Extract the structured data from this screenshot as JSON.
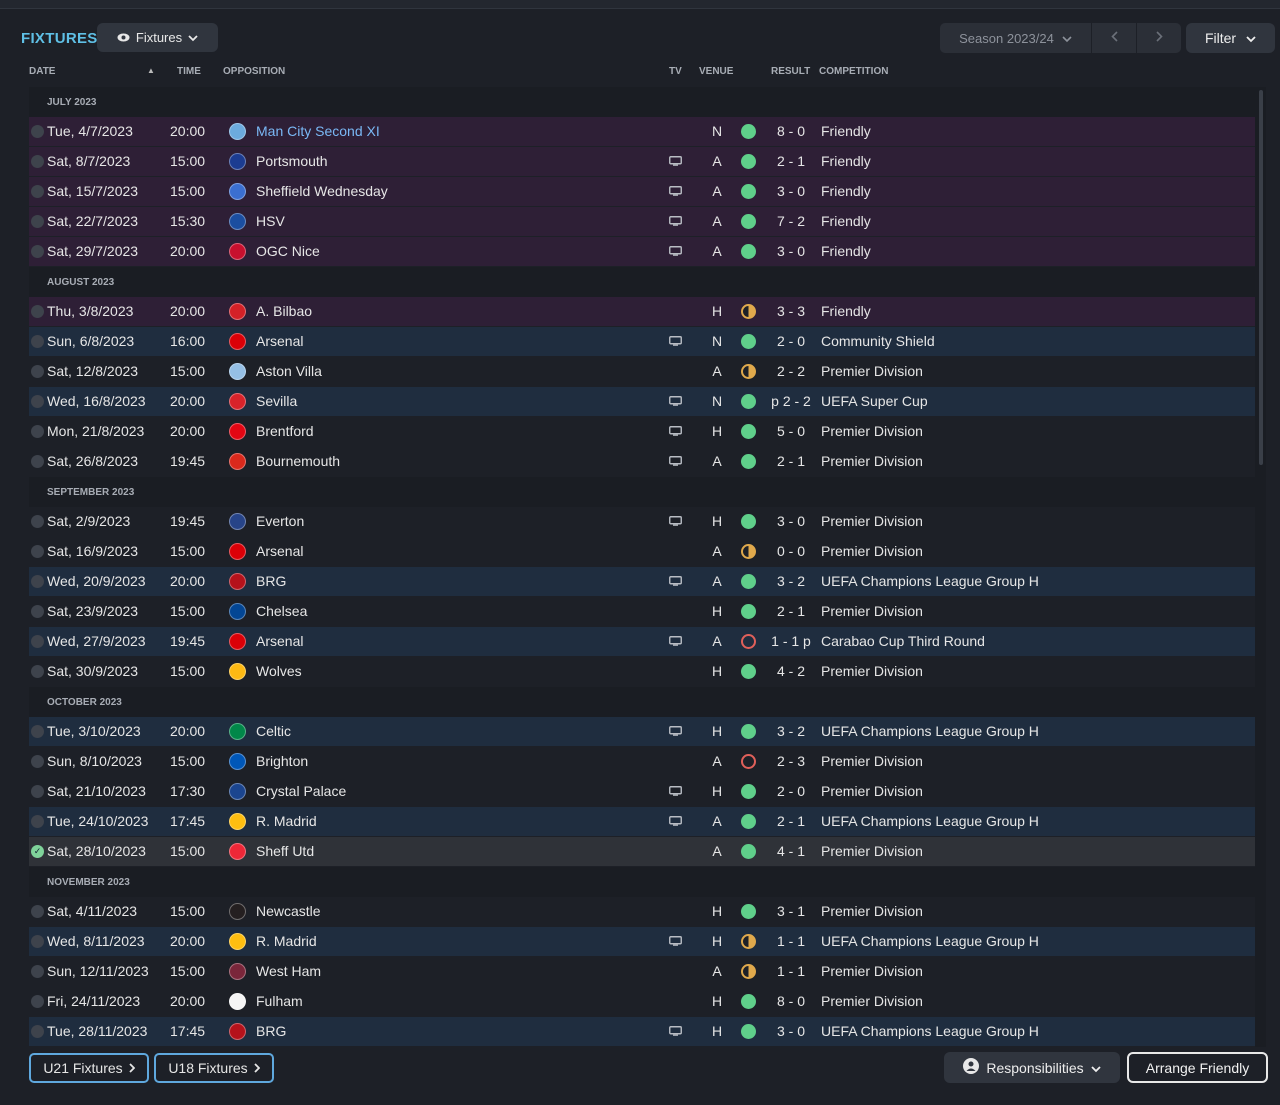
{
  "header": {
    "title": "FIXTURES",
    "view_label": "Fixtures",
    "season_label": "Season 2023/24",
    "filter_label": "Filter"
  },
  "columns": {
    "date": "DATE",
    "time": "TIME",
    "opposition": "OPPOSITION",
    "tv": "TV",
    "venue": "VENUE",
    "result": "RESULT",
    "competition": "COMPETITION"
  },
  "colors": {
    "accent": "#5fc0e6",
    "win": "#5fcf8a",
    "draw": "#e0a94c",
    "loss": "#e0605a",
    "friendly_row": "#2e1f36",
    "cup_row": "#1f2d3f"
  },
  "months": [
    {
      "label": "JULY 2023",
      "fixtures": [
        {
          "date": "Tue, 4/7/2023",
          "time": "20:00",
          "opposition": "Man City Second XI",
          "crest": "#6cabdd",
          "tv": false,
          "venue": "N",
          "result": "W",
          "score": "8 - 0",
          "competition": "Friendly",
          "style": "friendly",
          "link": true,
          "checked": false
        },
        {
          "date": "Sat, 8/7/2023",
          "time": "15:00",
          "opposition": "Portsmouth",
          "crest": "#1c3c91",
          "tv": true,
          "venue": "A",
          "result": "W",
          "score": "2 - 1",
          "competition": "Friendly",
          "style": "friendly",
          "checked": false
        },
        {
          "date": "Sat, 15/7/2023",
          "time": "15:00",
          "opposition": "Sheffield Wednesday",
          "crest": "#3b6fd0",
          "tv": true,
          "venue": "A",
          "result": "W",
          "score": "3 - 0",
          "competition": "Friendly",
          "style": "friendly",
          "checked": false
        },
        {
          "date": "Sat, 22/7/2023",
          "time": "15:30",
          "opposition": "HSV",
          "crest": "#1b4ea0",
          "tv": true,
          "venue": "A",
          "result": "W",
          "score": "7 - 2",
          "competition": "Friendly",
          "style": "friendly",
          "checked": false
        },
        {
          "date": "Sat, 29/7/2023",
          "time": "20:00",
          "opposition": "OGC Nice",
          "crest": "#c8102e",
          "tv": true,
          "venue": "A",
          "result": "W",
          "score": "3 - 0",
          "competition": "Friendly",
          "style": "friendly",
          "checked": false
        }
      ]
    },
    {
      "label": "AUGUST 2023",
      "fixtures": [
        {
          "date": "Thu, 3/8/2023",
          "time": "20:00",
          "opposition": "A. Bilbao",
          "crest": "#d42127",
          "tv": false,
          "venue": "H",
          "result": "D",
          "score": "3 - 3",
          "competition": "Friendly",
          "style": "friendly",
          "checked": false
        },
        {
          "date": "Sun, 6/8/2023",
          "time": "16:00",
          "opposition": "Arsenal",
          "crest": "#db0007",
          "tv": true,
          "venue": "N",
          "result": "W",
          "score": "2 - 0",
          "competition": "Community Shield",
          "style": "cup",
          "checked": false
        },
        {
          "date": "Sat, 12/8/2023",
          "time": "15:00",
          "opposition": "Aston Villa",
          "crest": "#95bfe5",
          "tv": false,
          "venue": "A",
          "result": "D",
          "score": "2 - 2",
          "competition": "Premier Division",
          "style": "plain",
          "checked": false
        },
        {
          "date": "Wed, 16/8/2023",
          "time": "20:00",
          "opposition": "Sevilla",
          "crest": "#d8232a",
          "tv": true,
          "venue": "N",
          "result": "W",
          "score": "p 2 - 2",
          "competition": "UEFA Super Cup",
          "style": "cup",
          "checked": false
        },
        {
          "date": "Mon, 21/8/2023",
          "time": "20:00",
          "opposition": "Brentford",
          "crest": "#e30613",
          "tv": true,
          "venue": "H",
          "result": "W",
          "score": "5 - 0",
          "competition": "Premier Division",
          "style": "plain",
          "checked": false
        },
        {
          "date": "Sat, 26/8/2023",
          "time": "19:45",
          "opposition": "Bournemouth",
          "crest": "#da291c",
          "tv": true,
          "venue": "A",
          "result": "W",
          "score": "2 - 1",
          "competition": "Premier Division",
          "style": "plain",
          "checked": false
        }
      ]
    },
    {
      "label": "SEPTEMBER 2023",
      "fixtures": [
        {
          "date": "Sat, 2/9/2023",
          "time": "19:45",
          "opposition": "Everton",
          "crest": "#274488",
          "tv": true,
          "venue": "H",
          "result": "W",
          "score": "3 - 0",
          "competition": "Premier Division",
          "style": "plain",
          "checked": false
        },
        {
          "date": "Sat, 16/9/2023",
          "time": "15:00",
          "opposition": "Arsenal",
          "crest": "#db0007",
          "tv": false,
          "venue": "A",
          "result": "D",
          "score": "0 - 0",
          "competition": "Premier Division",
          "style": "plain",
          "checked": false
        },
        {
          "date": "Wed, 20/9/2023",
          "time": "20:00",
          "opposition": "BRG",
          "crest": "#b5121b",
          "tv": true,
          "venue": "A",
          "result": "W",
          "score": "3 - 2",
          "competition": "UEFA Champions League Group H",
          "style": "cup",
          "checked": false
        },
        {
          "date": "Sat, 23/9/2023",
          "time": "15:00",
          "opposition": "Chelsea",
          "crest": "#034694",
          "tv": false,
          "venue": "H",
          "result": "W",
          "score": "2 - 1",
          "competition": "Premier Division",
          "style": "plain",
          "checked": false
        },
        {
          "date": "Wed, 27/9/2023",
          "time": "19:45",
          "opposition": "Arsenal",
          "crest": "#db0007",
          "tv": true,
          "venue": "A",
          "result": "L",
          "score": "1 - 1 p",
          "competition": "Carabao Cup Third Round",
          "style": "cup",
          "checked": false
        },
        {
          "date": "Sat, 30/9/2023",
          "time": "15:00",
          "opposition": "Wolves",
          "crest": "#fdb913",
          "tv": false,
          "venue": "H",
          "result": "W",
          "score": "4 - 2",
          "competition": "Premier Division",
          "style": "plain",
          "checked": false
        }
      ]
    },
    {
      "label": "OCTOBER 2023",
      "fixtures": [
        {
          "date": "Tue, 3/10/2023",
          "time": "20:00",
          "opposition": "Celtic",
          "crest": "#018749",
          "tv": true,
          "venue": "H",
          "result": "W",
          "score": "3 - 2",
          "competition": "UEFA Champions League Group H",
          "style": "cup",
          "checked": false
        },
        {
          "date": "Sun, 8/10/2023",
          "time": "15:00",
          "opposition": "Brighton",
          "crest": "#0057b8",
          "tv": false,
          "venue": "A",
          "result": "L",
          "score": "2 - 3",
          "competition": "Premier Division",
          "style": "plain",
          "checked": false
        },
        {
          "date": "Sat, 21/10/2023",
          "time": "17:30",
          "opposition": "Crystal Palace",
          "crest": "#1b458f",
          "tv": true,
          "venue": "H",
          "result": "W",
          "score": "2 - 0",
          "competition": "Premier Division",
          "style": "plain",
          "checked": false
        },
        {
          "date": "Tue, 24/10/2023",
          "time": "17:45",
          "opposition": "R. Madrid",
          "crest": "#febe10",
          "tv": true,
          "venue": "A",
          "result": "W",
          "score": "2 - 1",
          "competition": "UEFA Champions League Group H",
          "style": "cup",
          "checked": false
        },
        {
          "date": "Sat, 28/10/2023",
          "time": "15:00",
          "opposition": "Sheff Utd",
          "crest": "#ee2737",
          "tv": false,
          "venue": "A",
          "result": "W",
          "score": "4 - 1",
          "competition": "Premier Division",
          "style": "sel",
          "checked": true
        }
      ]
    },
    {
      "label": "NOVEMBER 2023",
      "fixtures": [
        {
          "date": "Sat, 4/11/2023",
          "time": "15:00",
          "opposition": "Newcastle",
          "crest": "#241f20",
          "tv": false,
          "venue": "H",
          "result": "W",
          "score": "3 - 1",
          "competition": "Premier Division",
          "style": "plain",
          "checked": false
        },
        {
          "date": "Wed, 8/11/2023",
          "time": "20:00",
          "opposition": "R. Madrid",
          "crest": "#febe10",
          "tv": true,
          "venue": "H",
          "result": "D",
          "score": "1 - 1",
          "competition": "UEFA Champions League Group H",
          "style": "cup",
          "checked": false
        },
        {
          "date": "Sun, 12/11/2023",
          "time": "15:00",
          "opposition": "West Ham",
          "crest": "#7a263a",
          "tv": false,
          "venue": "A",
          "result": "D",
          "score": "1 - 1",
          "competition": "Premier Division",
          "style": "plain",
          "checked": false
        },
        {
          "date": "Fri, 24/11/2023",
          "time": "20:00",
          "opposition": "Fulham",
          "crest": "#f5f5f5",
          "tv": false,
          "venue": "H",
          "result": "W",
          "score": "8 - 0",
          "competition": "Premier Division",
          "style": "plain",
          "checked": false
        },
        {
          "date": "Tue, 28/11/2023",
          "time": "17:45",
          "opposition": "BRG",
          "crest": "#b5121b",
          "tv": true,
          "venue": "H",
          "result": "W",
          "score": "3 - 0",
          "competition": "UEFA Champions League Group H",
          "style": "cup",
          "checked": false
        }
      ]
    }
  ],
  "footer": {
    "u21_label": "U21 Fixtures",
    "u18_label": "U18 Fixtures",
    "responsibilities_label": "Responsibilities",
    "arrange_label": "Arrange Friendly"
  }
}
